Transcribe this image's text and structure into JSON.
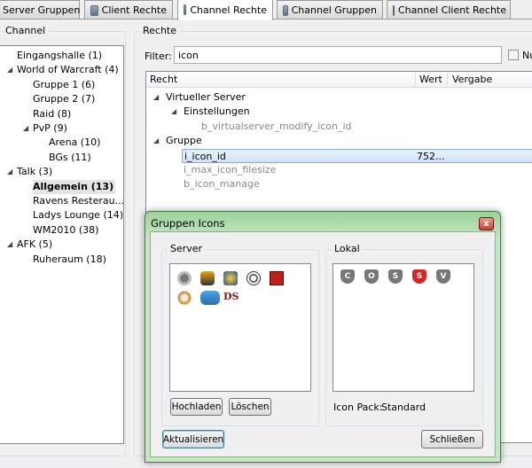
{
  "tabs": [
    {
      "label": "Server Gruppen"
    },
    {
      "label": "Client Rechte"
    },
    {
      "label": "Channel Rechte",
      "active": true
    },
    {
      "label": "Channel Gruppen"
    },
    {
      "label": "Channel Client Rechte"
    }
  ],
  "channel_panel": {
    "title": "Channel",
    "items": [
      {
        "label": "Eingangshalle (1)",
        "level": 0,
        "expander": false
      },
      {
        "label": "World of Warcraft (4)",
        "level": 0,
        "expander": true
      },
      {
        "label": "Gruppe 1 (6)",
        "level": 1,
        "expander": false
      },
      {
        "label": "Gruppe 2 (7)",
        "level": 1,
        "expander": false
      },
      {
        "label": "Raid (8)",
        "level": 1,
        "expander": false
      },
      {
        "label": "PvP (9)",
        "level": 1,
        "expander": true
      },
      {
        "label": "Arena (10)",
        "level": 2,
        "expander": false
      },
      {
        "label": "BGs (11)",
        "level": 2,
        "expander": false
      },
      {
        "label": "Talk (3)",
        "level": 0,
        "expander": true
      },
      {
        "label": "Allgemein (13)",
        "level": 1,
        "expander": false,
        "selected": true
      },
      {
        "label": "Ravens Resterau...",
        "level": 1,
        "expander": false
      },
      {
        "label": "Ladys Lounge (14)",
        "level": 1,
        "expander": false
      },
      {
        "label": "WM2010 (38)",
        "level": 1,
        "expander": false
      },
      {
        "label": "AFK (5)",
        "level": 0,
        "expander": true
      },
      {
        "label": "Ruheraum (18)",
        "level": 1,
        "expander": false
      }
    ]
  },
  "rechte_panel": {
    "title": "Rechte",
    "filter_label": "Filter:",
    "filter_value": "icon",
    "checkbox_label": "Nu",
    "columns": [
      "Recht",
      "Wert",
      "Vergabe"
    ],
    "rows": [
      {
        "label": "Virtueller Server",
        "level": 0,
        "expander": true,
        "gray": false,
        "value": ""
      },
      {
        "label": "Einstellungen",
        "level": 1,
        "expander": true,
        "gray": false,
        "value": ""
      },
      {
        "label": "b_virtualserver_modify_icon_id",
        "level": 2,
        "expander": false,
        "gray": true,
        "value": ""
      },
      {
        "label": "Gruppe",
        "level": 0,
        "expander": true,
        "gray": false,
        "value": ""
      },
      {
        "label": "i_icon_id",
        "level": 1,
        "expander": false,
        "gray": false,
        "value": "752...",
        "selected": true
      },
      {
        "label": "i_max_icon_filesize",
        "level": 1,
        "expander": false,
        "gray": true,
        "value": ""
      },
      {
        "label": "b_icon_manage",
        "level": 1,
        "expander": false,
        "gray": true,
        "value": ""
      }
    ]
  },
  "dialog": {
    "title": "Gruppen Icons",
    "server_label": "Server",
    "lokal_label": "Lokal",
    "server_icons": [
      "clock-icon",
      "warrior-icon",
      "wow-icon",
      "soccer-ball-icon",
      "horde-icon",
      "phoenix-icon",
      "chat-bubble-icon",
      "ds-logo-icon"
    ],
    "ds_text": "DS",
    "lokal_icons": [
      {
        "name": "shield-c-icon",
        "letter": "C",
        "color": "#777"
      },
      {
        "name": "shield-o-icon",
        "letter": "O",
        "color": "#777"
      },
      {
        "name": "shield-s-icon",
        "letter": "S",
        "color": "#777"
      },
      {
        "name": "shield-s-red-icon",
        "letter": "S",
        "color": "#d22"
      },
      {
        "name": "shield-v-icon",
        "letter": "V",
        "color": "#777"
      }
    ],
    "upload_label": "Hochladen",
    "delete_label": "Löschen",
    "icon_pack_label": "Icon Pack:",
    "icon_pack_value": "Standard",
    "refresh_label": "Aktualisieren",
    "close_label": "Schließen"
  }
}
